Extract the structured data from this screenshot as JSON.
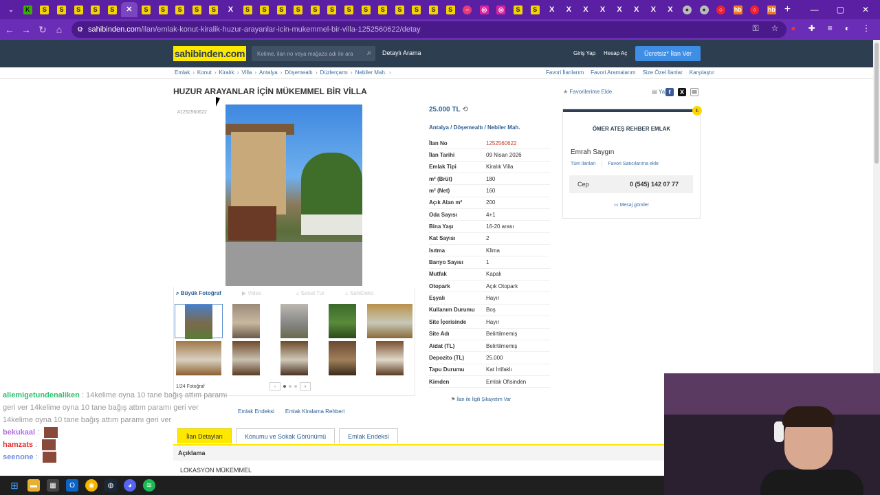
{
  "browser": {
    "tabs": [
      {
        "icon": "k-icon",
        "glyph": "K",
        "cls": "f-k"
      },
      {
        "icon": "s-icon",
        "glyph": "S",
        "cls": "f-s"
      },
      {
        "icon": "s-icon",
        "glyph": "S",
        "cls": "f-s"
      },
      {
        "icon": "s-icon",
        "glyph": "S",
        "cls": "f-s"
      },
      {
        "icon": "s-icon",
        "glyph": "S",
        "cls": "f-s"
      },
      {
        "icon": "s-icon",
        "glyph": "S",
        "cls": "f-s"
      },
      {
        "icon": "close-icon",
        "glyph": "✕",
        "cls": "f-x",
        "active": true
      },
      {
        "icon": "s-icon",
        "glyph": "S",
        "cls": "f-s"
      },
      {
        "icon": "s-icon",
        "glyph": "S",
        "cls": "f-s"
      },
      {
        "icon": "s-icon",
        "glyph": "S",
        "cls": "f-s"
      },
      {
        "icon": "s-icon",
        "glyph": "S",
        "cls": "f-s"
      },
      {
        "icon": "s-icon",
        "glyph": "S",
        "cls": "f-s"
      },
      {
        "icon": "x-icon",
        "glyph": "X",
        "cls": "f-x"
      },
      {
        "icon": "s-icon",
        "glyph": "S",
        "cls": "f-s"
      },
      {
        "icon": "s-icon",
        "glyph": "S",
        "cls": "f-s"
      },
      {
        "icon": "s-icon",
        "glyph": "S",
        "cls": "f-s"
      },
      {
        "icon": "s-icon",
        "glyph": "S",
        "cls": "f-s"
      },
      {
        "icon": "s-icon",
        "glyph": "S",
        "cls": "f-s"
      },
      {
        "icon": "s-icon",
        "glyph": "S",
        "cls": "f-s"
      },
      {
        "icon": "s-icon",
        "glyph": "S",
        "cls": "f-s"
      },
      {
        "icon": "s-icon",
        "glyph": "S",
        "cls": "f-s"
      },
      {
        "icon": "s-icon",
        "glyph": "S",
        "cls": "f-s"
      },
      {
        "icon": "s-icon",
        "glyph": "S",
        "cls": "f-s"
      },
      {
        "icon": "s-icon",
        "glyph": "S",
        "cls": "f-s"
      },
      {
        "icon": "s-icon",
        "glyph": "S",
        "cls": "f-s"
      },
      {
        "icon": "s-icon",
        "glyph": "S",
        "cls": "f-s"
      },
      {
        "icon": "pink-icon",
        "glyph": "–",
        "cls": "f-pink"
      },
      {
        "icon": "instagram-icon",
        "glyph": "◎",
        "cls": "f-insta"
      },
      {
        "icon": "instagram-icon",
        "glyph": "◎",
        "cls": "f-insta"
      },
      {
        "icon": "s-icon",
        "glyph": "S",
        "cls": "f-s"
      },
      {
        "icon": "s-icon",
        "glyph": "S",
        "cls": "f-s"
      },
      {
        "icon": "x-icon",
        "glyph": "X",
        "cls": "f-x"
      },
      {
        "icon": "x-icon",
        "glyph": "X",
        "cls": "f-x"
      },
      {
        "icon": "x-icon",
        "glyph": "X",
        "cls": "f-x"
      },
      {
        "icon": "x-icon",
        "glyph": "X",
        "cls": "f-x"
      },
      {
        "icon": "x-icon",
        "glyph": "X",
        "cls": "f-x"
      },
      {
        "icon": "x-icon",
        "glyph": "X",
        "cls": "f-x"
      },
      {
        "icon": "x-icon",
        "glyph": "X",
        "cls": "f-x"
      },
      {
        "icon": "x-icon",
        "glyph": "X",
        "cls": "f-x"
      },
      {
        "icon": "globe-icon",
        "glyph": "●",
        "cls": "f-gray"
      },
      {
        "icon": "chrome-icon",
        "glyph": "●",
        "cls": "f-gray"
      },
      {
        "icon": "red-icon",
        "glyph": "○",
        "cls": "f-red"
      },
      {
        "icon": "hb-icon",
        "glyph": "hb",
        "cls": "f-hb"
      },
      {
        "icon": "red-icon",
        "glyph": "○",
        "cls": "f-red"
      },
      {
        "icon": "hb-icon",
        "glyph": "hb",
        "cls": "f-hb"
      }
    ],
    "url_domain": "sahibinden.com",
    "url_path": "/ilan/emlak-konut-kiralik-huzur-arayanlar-icin-mukemmel-bir-villa-1252560622/detay"
  },
  "header": {
    "logo": "sahibinden.com",
    "search_placeholder": "Kelime, ilan no veya mağaza adı ile ara",
    "detailed_search": "Detaylı Arama",
    "login": "Giriş Yap",
    "register": "Hesap Aç",
    "post_ad": "Ücretsiz* İlan Ver"
  },
  "breadcrumb": [
    "Emlak",
    "Konut",
    "Kiralık",
    "Villa",
    "Antalya",
    "Döşemealtı",
    "Düzlerçamı",
    "Nebiler Mah."
  ],
  "toplinks": [
    "Favori İlanlarım",
    "Favori Aramalarım",
    "Size Özel İlanlar",
    "Karşılaştır"
  ],
  "listing": {
    "title": "HUZUR ARAYANLAR İÇİN MÜKEMMEL BİR VİLLA",
    "add_favorite": "Favorilerime Ekle",
    "print": "Yazdır",
    "ad_no_label": "#1252560622",
    "price": "25.000 TL",
    "location": [
      "Antalya",
      "Döşemealtı",
      "Nebiler Mah."
    ],
    "photo_tabs": [
      "Büyük Fotoğraf",
      "Video",
      "Sanal Tur",
      "SahiDeko"
    ],
    "photo_count": "1/24 Fotoğraf",
    "specs": [
      {
        "k": "İlan No",
        "v": "1252560622",
        "red": true
      },
      {
        "k": "İlan Tarihi",
        "v": "09 Nisan 2026"
      },
      {
        "k": "Emlak Tipi",
        "v": "Kiralık Villa"
      },
      {
        "k": "m² (Brüt)",
        "v": "180"
      },
      {
        "k": "m² (Net)",
        "v": "160"
      },
      {
        "k": "Açık Alan m²",
        "v": "200"
      },
      {
        "k": "Oda Sayısı",
        "v": "4+1"
      },
      {
        "k": "Bina Yaşı",
        "v": "16-20 arası"
      },
      {
        "k": "Kat Sayısı",
        "v": "2"
      },
      {
        "k": "Isıtma",
        "v": "Klima"
      },
      {
        "k": "Banyo Sayısı",
        "v": "1"
      },
      {
        "k": "Mutfak",
        "v": "Kapalı"
      },
      {
        "k": "Otopark",
        "v": "Açık Otopark"
      },
      {
        "k": "Eşyalı",
        "v": "Hayır"
      },
      {
        "k": "Kullanım Durumu",
        "v": "Boş"
      },
      {
        "k": "Site İçerisinde",
        "v": "Hayır"
      },
      {
        "k": "Site Adı",
        "v": "Belirtilmemiş"
      },
      {
        "k": "Aidat (TL)",
        "v": "Belirtilmemiş"
      },
      {
        "k": "Depozito (TL)",
        "v": "25.000"
      },
      {
        "k": "Tapu Durumu",
        "v": "Kat İrtifaklı"
      },
      {
        "k": "Kimden",
        "v": "Emlak Ofisinden"
      }
    ],
    "complaint": "İlan ile İlgili Şikayetim Var"
  },
  "seller": {
    "agency": "ÖMER ATEŞ REHBER EMLAK",
    "agent": "Emrah Saygın",
    "links": [
      "Tüm ilanları",
      "Favori Satıcılarıma ekle"
    ],
    "phone_label": "Cep",
    "phone": "0 (545) 142 07 77",
    "message": "Mesaj gönder",
    "badge": "₺"
  },
  "bottom_links": [
    "Emlak Endeksi",
    "Emlak Kiralama Rehberi"
  ],
  "detail_tabs": [
    "İlan Detayları",
    "Konumu ve Sokak Görünümü",
    "Emlak Endeksi"
  ],
  "description_header": "Açıklama",
  "description_first": "LOKASYON MÜKEMMEL",
  "chat": [
    {
      "user": "aliemigetundenaliken",
      "cls": "cu1",
      "text": "14kelime oyna 10 tane bağış attım paramı geri ver 14kelime oyna 10 tane bağış attım paramı geri ver 14kelime oyna 10 tane bağış attım paramı geri ver"
    },
    {
      "user": "bekukaal",
      "cls": "cu2",
      "text": ""
    },
    {
      "user": "hamzats",
      "cls": "cu3",
      "text": ""
    },
    {
      "user": "seenone",
      "cls": "cu4",
      "text": ""
    }
  ],
  "colors": {
    "brand_yellow": "#ffe800",
    "header": "#2d3e50",
    "link": "#2c5f94",
    "browser": "#5b1fa3"
  }
}
